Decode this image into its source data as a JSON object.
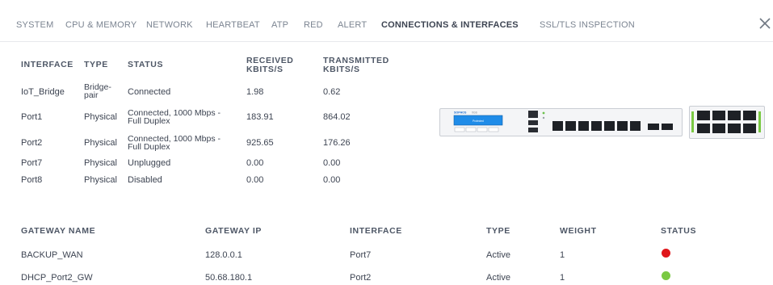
{
  "tabs": [
    {
      "label": "SYSTEM",
      "active": false
    },
    {
      "label": "CPU & MEMORY",
      "active": false
    },
    {
      "label": "NETWORK",
      "active": false
    },
    {
      "label": "HEARTBEAT",
      "active": false
    },
    {
      "label": "ATP",
      "active": false
    },
    {
      "label": "RED",
      "active": false
    },
    {
      "label": "ALERT",
      "active": false
    },
    {
      "label": "CONNECTIONS & INTERFACES",
      "active": true
    },
    {
      "label": "SSL/TLS INSPECTION",
      "active": false
    }
  ],
  "interfaces": {
    "headers": {
      "interface": "INTERFACE",
      "type": "TYPE",
      "status": "STATUS",
      "received_1": "RECEIVED",
      "received_2": "KBITS/S",
      "transmitted_1": "TRANSMITTED",
      "transmitted_2": "KBITS/S"
    },
    "rows": [
      {
        "interface": "IoT_Bridge",
        "type_1": "Bridge-",
        "type_2": "pair",
        "status_1": "Connected",
        "status_2": "",
        "received": "1.98",
        "transmitted": "0.62"
      },
      {
        "interface": "Port1",
        "type_1": "Physical",
        "type_2": "",
        "status_1": "Connected, 1000 Mbps -",
        "status_2": "Full Duplex",
        "received": "183.91",
        "transmitted": "864.02"
      },
      {
        "interface": "Port2",
        "type_1": "Physical",
        "type_2": "",
        "status_1": "Connected, 1000 Mbps -",
        "status_2": "Full Duplex",
        "received": "925.65",
        "transmitted": "176.26"
      },
      {
        "interface": "Port7",
        "type_1": "Physical",
        "type_2": "",
        "status_1": "Unplugged",
        "status_2": "",
        "received": "0.00",
        "transmitted": "0.00"
      },
      {
        "interface": "Port8",
        "type_1": "Physical",
        "type_2": "",
        "status_1": "Disabled",
        "status_2": "",
        "received": "0.00",
        "transmitted": "0.00"
      }
    ]
  },
  "gateways": {
    "headers": {
      "name": "GATEWAY NAME",
      "ip": "GATEWAY IP",
      "interface": "INTERFACE",
      "type": "TYPE",
      "weight": "WEIGHT",
      "status": "STATUS"
    },
    "rows": [
      {
        "name": "BACKUP_WAN",
        "ip": "128.0.0.1",
        "interface": "Port7",
        "type": "Active",
        "weight": "1",
        "status_color": "#e0161b"
      },
      {
        "name": "DHCP_Port2_GW",
        "ip": "50.68.180.1",
        "interface": "Port2",
        "type": "Active",
        "weight": "1",
        "status_color": "#7ac943"
      }
    ]
  },
  "device": {
    "brand": "SOPHOS",
    "model": "XGS",
    "screen_text": "Protected"
  },
  "icons": {
    "close": "close-icon"
  }
}
